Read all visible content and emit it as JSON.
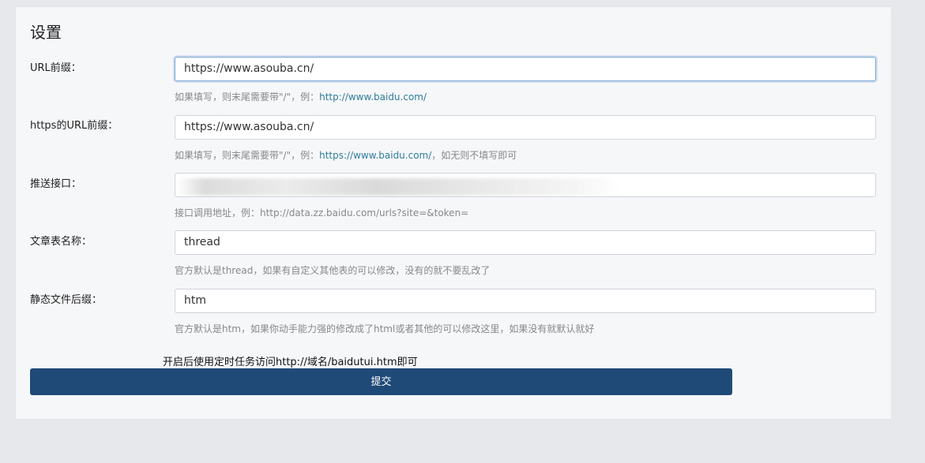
{
  "page": {
    "title": "设置"
  },
  "fields": {
    "url_prefix": {
      "label": "URL前缀：",
      "value": "https://www.asouba.cn/",
      "help_text": "如果填写，则末尾需要带\"/\"，例：",
      "help_link": "http://www.baidu.com/"
    },
    "https_url_prefix": {
      "label": "https的URL前缀：",
      "value": "https://www.asouba.cn/",
      "help_text": "如果填写，则末尾需要带\"/\"，例：",
      "help_link": "https://www.baidu.com/",
      "help_suffix": "，如无则不填写即可"
    },
    "push_api": {
      "label": "推送接口：",
      "value": "",
      "help_text": "接口调用地址，例：http://data.zz.baidu.com/urls?site=&token="
    },
    "table_name": {
      "label": "文章表名称：",
      "value": "thread",
      "help_text": "官方默认是thread，如果有自定义其他表的可以修改，没有的就不要乱改了"
    },
    "static_suffix": {
      "label": "静态文件后缀：",
      "value": "htm",
      "help_text": "官方默认是htm，如果你动手能力强的修改成了html或者其他的可以修改这里，如果没有就默认就好"
    }
  },
  "notice": "开启后使用定时任务访问http://域名/baidutui.htm即可",
  "submit_label": "提交",
  "colors": {
    "background": "#e7e8eb",
    "card": "#f6f7f9",
    "submit": "#1f4a78",
    "link": "#2f7c9a"
  }
}
